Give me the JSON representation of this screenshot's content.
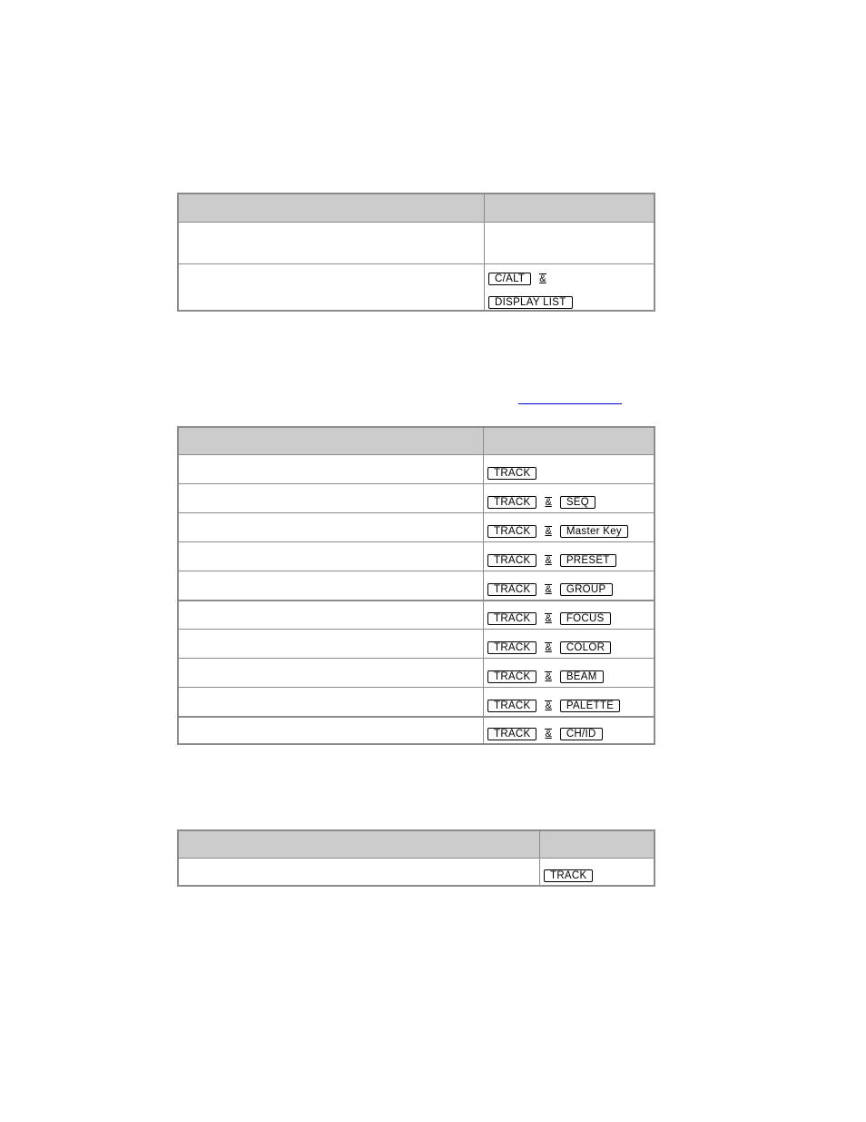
{
  "link": {
    "text": ""
  },
  "and_glyph": "&",
  "table1": {
    "rows": [
      {
        "keys": []
      },
      {
        "keys": [
          "C/ALT",
          "&",
          "DISPLAY LIST"
        ]
      }
    ]
  },
  "table2": {
    "rows": [
      {
        "keys": [
          "TRACK"
        ]
      },
      {
        "keys": [
          "TRACK",
          "&",
          "SEQ"
        ]
      },
      {
        "keys": [
          "TRACK",
          "&",
          "Master Key"
        ]
      },
      {
        "keys": [
          "TRACK",
          "&",
          "PRESET"
        ]
      },
      {
        "keys": [
          "TRACK",
          "&",
          "GROUP"
        ]
      },
      {
        "keys": [
          "TRACK",
          "&",
          "FOCUS"
        ]
      },
      {
        "keys": [
          "TRACK",
          "&",
          "COLOR"
        ]
      },
      {
        "keys": [
          "TRACK",
          "&",
          "BEAM"
        ]
      },
      {
        "keys": [
          "TRACK",
          "&",
          "PALETTE"
        ]
      },
      {
        "keys": [
          "TRACK",
          "&",
          "CH/ID"
        ]
      }
    ]
  },
  "table3": {
    "rows": [
      {
        "keys": [
          "TRACK"
        ]
      }
    ]
  }
}
